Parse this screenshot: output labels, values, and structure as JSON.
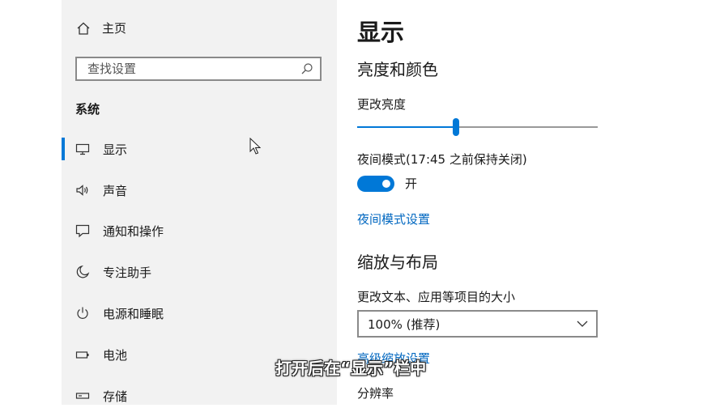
{
  "sidebar": {
    "home_label": "主页",
    "search": {
      "placeholder": "查找设置"
    },
    "section_title": "系统",
    "items": [
      {
        "label": "显示",
        "icon": "monitor-icon",
        "active": true
      },
      {
        "label": "声音",
        "icon": "speaker-icon"
      },
      {
        "label": "通知和操作",
        "icon": "notification-icon"
      },
      {
        "label": "专注助手",
        "icon": "moon-icon"
      },
      {
        "label": "电源和睡眠",
        "icon": "power-icon"
      },
      {
        "label": "电池",
        "icon": "battery-icon"
      },
      {
        "label": "存储",
        "icon": "storage-icon"
      }
    ]
  },
  "main": {
    "title": "显示",
    "brightness_section": {
      "heading": "亮度和颜色",
      "brightness_label": "更改亮度",
      "brightness_fraction": 0.41,
      "night_mode_label": "夜间模式(17:45 之前保持关闭)",
      "night_mode_state": "开",
      "night_mode_settings_link": "夜间模式设置"
    },
    "layout_section": {
      "heading": "缩放与布局",
      "scale_label": "更改文本、应用等项目的大小",
      "scale_value": "100% (推荐)",
      "advanced_link": "高级缩放设置",
      "resolution_label": "分辨率"
    }
  },
  "subtitle": "打开后在“显示”栏中",
  "colors": {
    "accent": "#0078d7",
    "link": "#0067c0",
    "sidebar_bg": "#f2f2f2"
  }
}
